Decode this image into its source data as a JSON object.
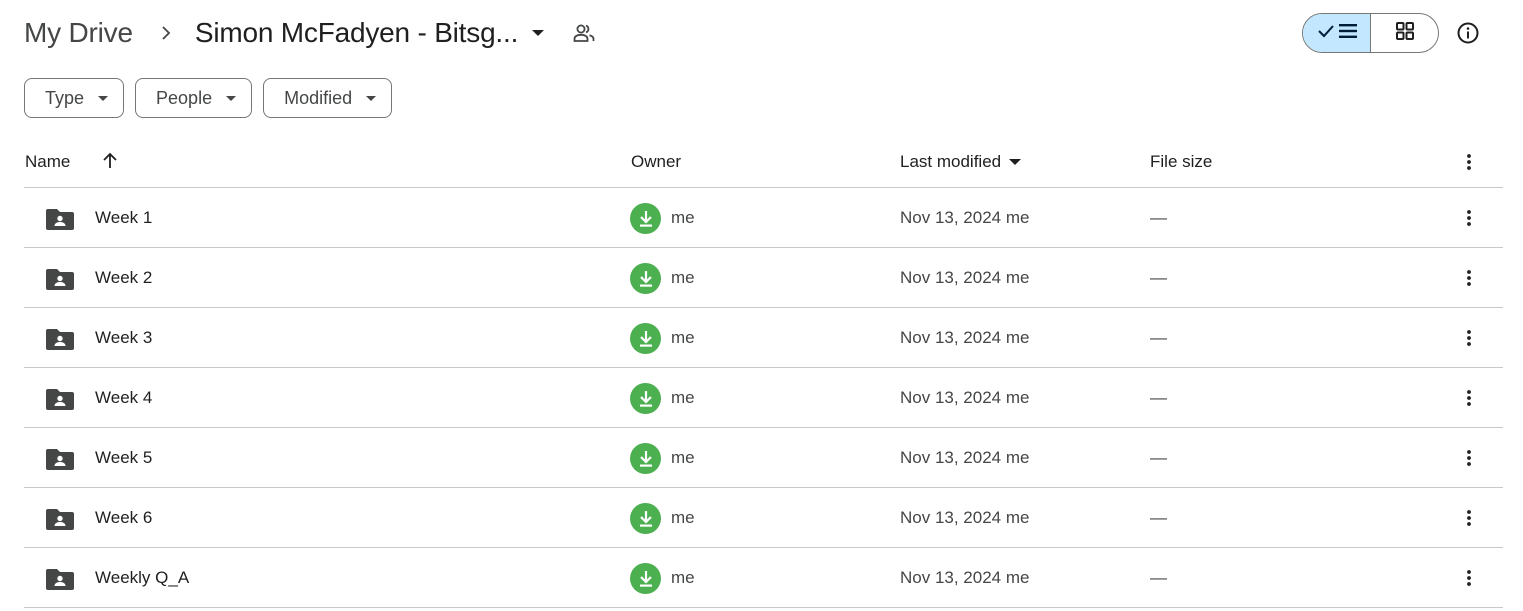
{
  "breadcrumb": {
    "root": "My Drive",
    "current": "Simon McFadyen - Bitsg...",
    "separator_icon": "chevron-right-icon",
    "shared_icon": "shared-people-icon"
  },
  "view_toggle": {
    "selected": "list",
    "options": [
      "list",
      "grid"
    ]
  },
  "filters": [
    {
      "label": "Type"
    },
    {
      "label": "People"
    },
    {
      "label": "Modified"
    }
  ],
  "table": {
    "columns": {
      "name": "Name",
      "owner": "Owner",
      "last_modified": "Last modified",
      "file_size": "File size"
    },
    "sort": {
      "column": "name",
      "direction": "ascending"
    },
    "rows": [
      {
        "name": "Week 1",
        "owner": "me",
        "modified": "Nov 13, 2024 me",
        "size": "—"
      },
      {
        "name": "Week 2",
        "owner": "me",
        "modified": "Nov 13, 2024 me",
        "size": "—"
      },
      {
        "name": "Week 3",
        "owner": "me",
        "modified": "Nov 13, 2024 me",
        "size": "—"
      },
      {
        "name": "Week 4",
        "owner": "me",
        "modified": "Nov 13, 2024 me",
        "size": "—"
      },
      {
        "name": "Week 5",
        "owner": "me",
        "modified": "Nov 13, 2024 me",
        "size": "—"
      },
      {
        "name": "Week 6",
        "owner": "me",
        "modified": "Nov 13, 2024 me",
        "size": "—"
      },
      {
        "name": "Weekly Q_A",
        "owner": "me",
        "modified": "Nov 13, 2024 me",
        "size": "—"
      }
    ]
  },
  "colors": {
    "accent_selected": "#c2e7ff",
    "owner_avatar": "#4caf50",
    "divider": "#c7c7c7"
  }
}
